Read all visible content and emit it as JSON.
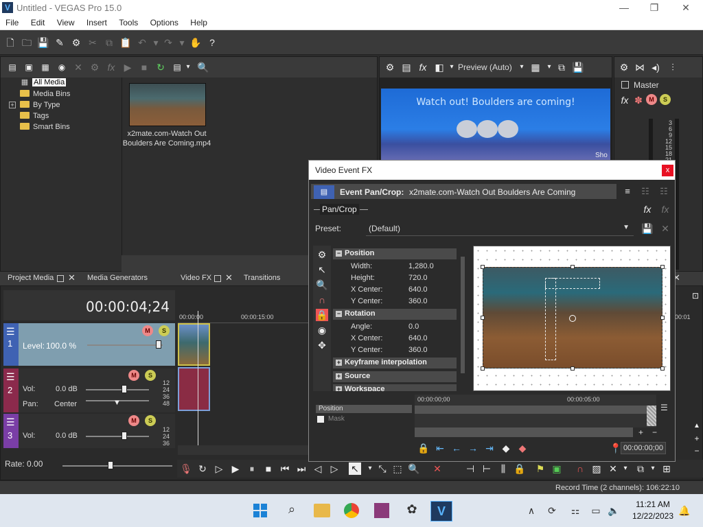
{
  "window": {
    "title": "Untitled - VEGAS Pro 15.0",
    "app_icon_letter": "V",
    "min": "—",
    "max": "❐",
    "close": "✕"
  },
  "menu": [
    "File",
    "Edit",
    "View",
    "Insert",
    "Tools",
    "Options",
    "Help"
  ],
  "media_tree": {
    "items": [
      {
        "label": "All Media",
        "selected": true
      },
      {
        "label": "Media Bins"
      },
      {
        "label": "By Type",
        "expand": "+"
      },
      {
        "label": "Tags"
      },
      {
        "label": "Smart Bins"
      }
    ],
    "file": {
      "name_line1": "x2mate.com-Watch Out",
      "name_line2": "Boulders Are Coming.mp4"
    }
  },
  "preview": {
    "mode": "Preview (Auto)",
    "caption": "Watch out! Boulders are coming!",
    "corner_text": "Sho"
  },
  "master": {
    "label": "Master",
    "meter_ticks": [
      "3",
      "6",
      "9",
      "12",
      "15",
      "18",
      "21"
    ]
  },
  "left_tabs": [
    "Project Media",
    "Media Generators"
  ],
  "center_tabs": [
    "Video FX",
    "Transitions"
  ],
  "timeline": {
    "timecode": "00:00:04;24",
    "ruler": [
      "00:00:00",
      "00:00:15:00",
      "00:01"
    ],
    "tracks": [
      {
        "num": "1",
        "level_label": "Level:",
        "level_value": "100.0 %"
      },
      {
        "num": "2",
        "vol_label": "Vol:",
        "vol_value": "0.0 dB",
        "pan_label": "Pan:",
        "pan_value": "Center",
        "meter": [
          "12",
          "24",
          "36",
          "48"
        ]
      },
      {
        "num": "3",
        "vol_label": "Vol:",
        "vol_value": "0.0 dB",
        "meter": [
          "12",
          "24",
          "36"
        ]
      }
    ],
    "rate": "Rate: 0.00"
  },
  "dialog": {
    "title": "Video Event FX",
    "close": "x",
    "header_label": "Event Pan/Crop:",
    "header_value": "x2mate.com-Watch Out Boulders Are Coming",
    "chain_label": "Pan/Crop",
    "preset_label": "Preset:",
    "preset_value": "(Default)",
    "sections": {
      "position": {
        "title": "Position",
        "rows": [
          {
            "label": "Width:",
            "value": "1,280.0"
          },
          {
            "label": "Height:",
            "value": "720.0"
          },
          {
            "label": "X Center:",
            "value": "640.0"
          },
          {
            "label": "Y Center:",
            "value": "360.0"
          }
        ]
      },
      "rotation": {
        "title": "Rotation",
        "rows": [
          {
            "label": "Angle:",
            "value": "0.0"
          },
          {
            "label": "X Center:",
            "value": "640.0"
          },
          {
            "label": "Y Center:",
            "value": "360.0"
          }
        ]
      },
      "collapsed": [
        "Keyframe interpolation",
        "Source",
        "Workspace"
      ]
    },
    "keyframe_ruler": [
      "00:00:00;00",
      "00:00:05:00"
    ],
    "keyframe_tracks": [
      "Position",
      "Mask"
    ],
    "timecode": "00:00:00;00"
  },
  "status": {
    "record_time": "Record Time (2 channels): 106:22:10"
  },
  "taskbar": {
    "time": "11:21 AM",
    "date": "12/22/2023"
  }
}
